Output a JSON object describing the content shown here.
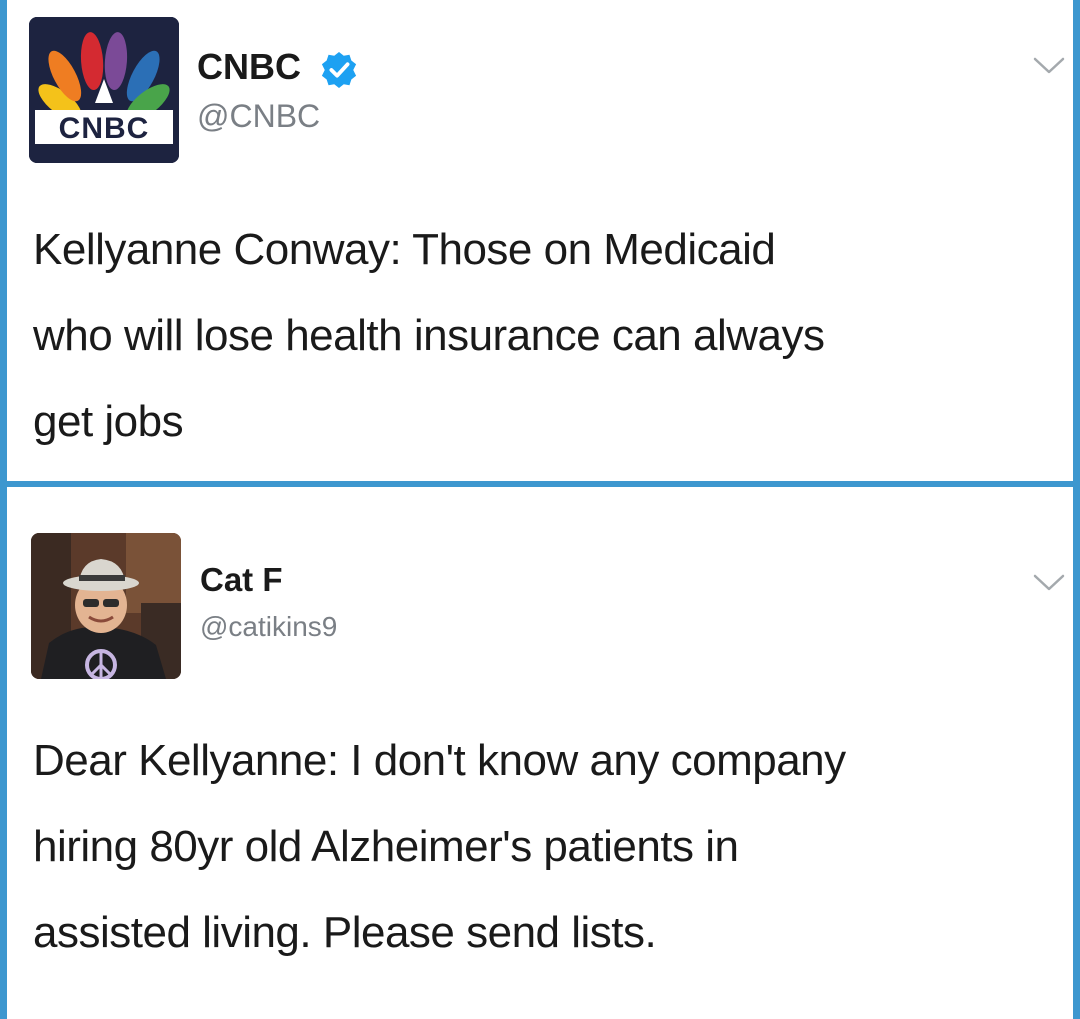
{
  "tweets": [
    {
      "display_name": "CNBC",
      "handle": "@CNBC",
      "verified": true,
      "avatar": {
        "type": "logo",
        "logo_text": "CNBC"
      },
      "text_lines": [
        "Kellyanne Conway: Those on Medicaid",
        "who will lose health insurance can always",
        "get jobs"
      ]
    },
    {
      "display_name": "Cat F",
      "handle": "@catikins9",
      "verified": false,
      "avatar": {
        "type": "photo"
      },
      "text_lines": [
        "Dear Kellyanne: I don't know any company",
        "hiring 80yr old Alzheimer's patients in",
        "assisted living. Please send lists."
      ]
    }
  ],
  "icons": {
    "verified": "verified-badge-icon",
    "menu": "chevron-down-icon"
  },
  "colors": {
    "border": "#3d97cf",
    "verified": "#1da1f2",
    "handle": "#7a7f85",
    "text": "#1a1a1a"
  }
}
